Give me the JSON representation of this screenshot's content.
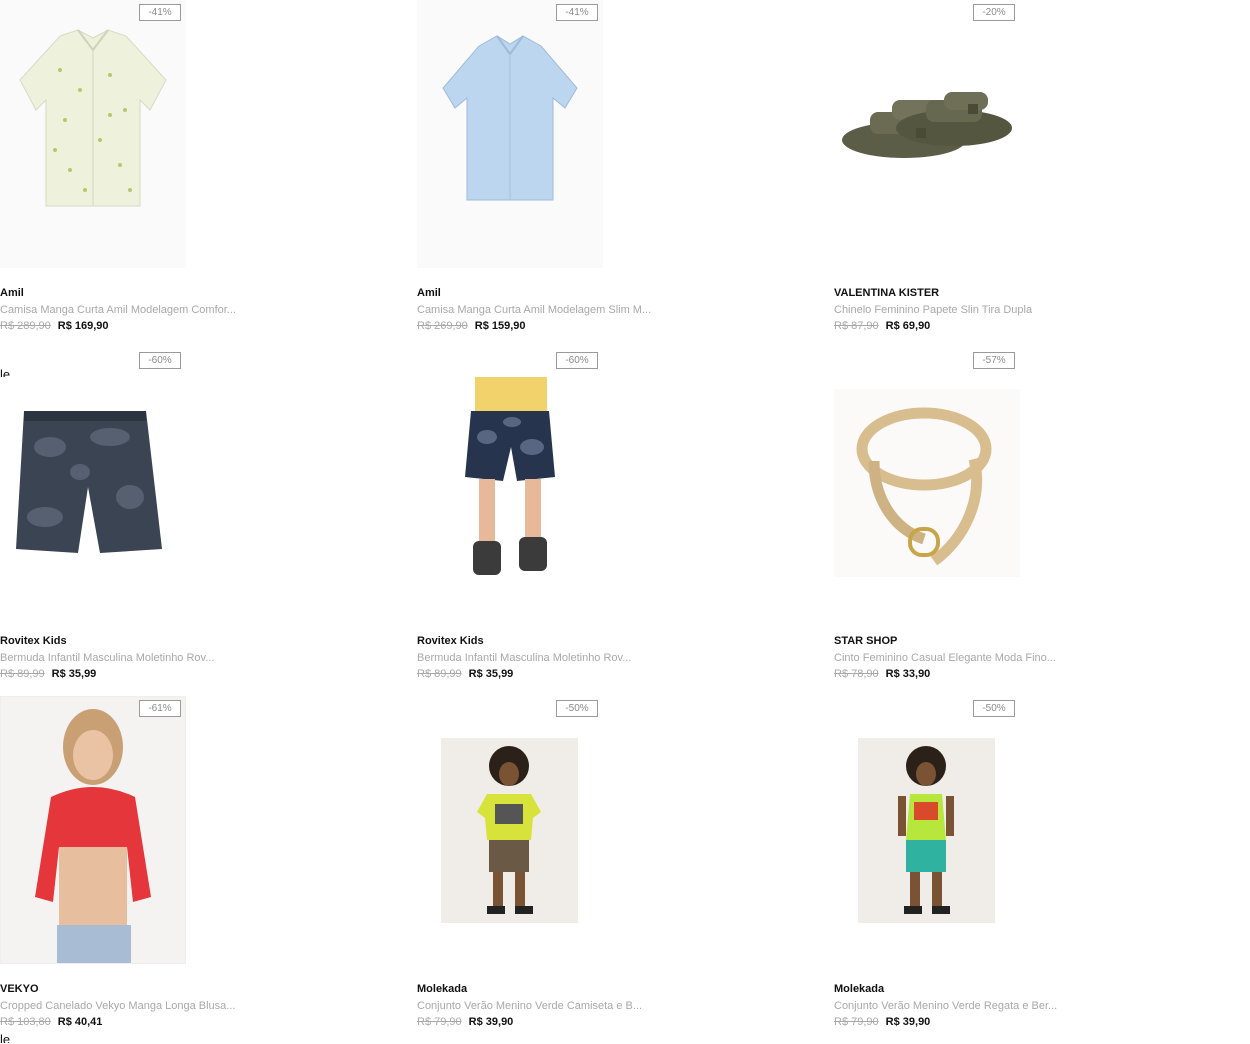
{
  "products": [
    {
      "badge": "-41%",
      "brand": "Amil",
      "description": "Camisa Manga Curta Amil Modelagem Comfor...",
      "old_price": "R$ 289,90",
      "price": "R$ 169,90",
      "image": "printed-short-sleeve-shirt"
    },
    {
      "badge": "-41%",
      "brand": "Amil",
      "description": "Camisa Manga Curta Amil Modelagem Slim M...",
      "old_price": "R$ 269,90",
      "price": "R$ 159,90",
      "image": "light-blue-short-sleeve-shirt"
    },
    {
      "badge": "-20%",
      "brand": "VALENTINA KISTER",
      "description": "Chinelo Feminino Papete Slin Tira Dupla",
      "old_price": "R$ 87,90",
      "price": "R$ 69,90",
      "image": "olive-buckle-sandals"
    },
    {
      "badge": "-60%",
      "brand": "Rovitex Kids",
      "description": "Bermuda Infantil Masculina Moletinho Rov...",
      "old_price": "R$ 89,99",
      "price": "R$ 35,99",
      "image": "tie-dye-shorts"
    },
    {
      "badge": "-60%",
      "brand": "Rovitex Kids",
      "description": "Bermuda Infantil Masculina Moletinho Rov...",
      "old_price": "R$ 89,99",
      "price": "R$ 35,99",
      "image": "child-wearing-tie-dye-shorts"
    },
    {
      "badge": "-57%",
      "brand": "STAR SHOP",
      "description": "Cinto Feminino Casual Elegante Moda Fino...",
      "old_price": "R$ 78,90",
      "price": "R$ 33,90",
      "image": "beige-belt"
    },
    {
      "badge": "-61%",
      "brand": "VEKYO",
      "description": "Cropped Canelado Vekyo Manga Longa Blusa...",
      "old_price": "R$ 103,80",
      "price": "R$ 40,41",
      "image": "red-cropped-top-model"
    },
    {
      "badge": "-50%",
      "brand": "Molekada",
      "description": "Conjunto Verão Menino Verde Camiseta e B...",
      "old_price": "R$ 79,90",
      "price": "R$ 39,90",
      "image": "boy-green-tshirt-set"
    },
    {
      "badge": "-50%",
      "brand": "Molekada",
      "description": "Conjunto Verão Menino Verde Regata e Ber...",
      "old_price": "R$ 79,90",
      "price": "R$ 39,90",
      "image": "boy-green-tank-set"
    }
  ],
  "stray_text": "le"
}
